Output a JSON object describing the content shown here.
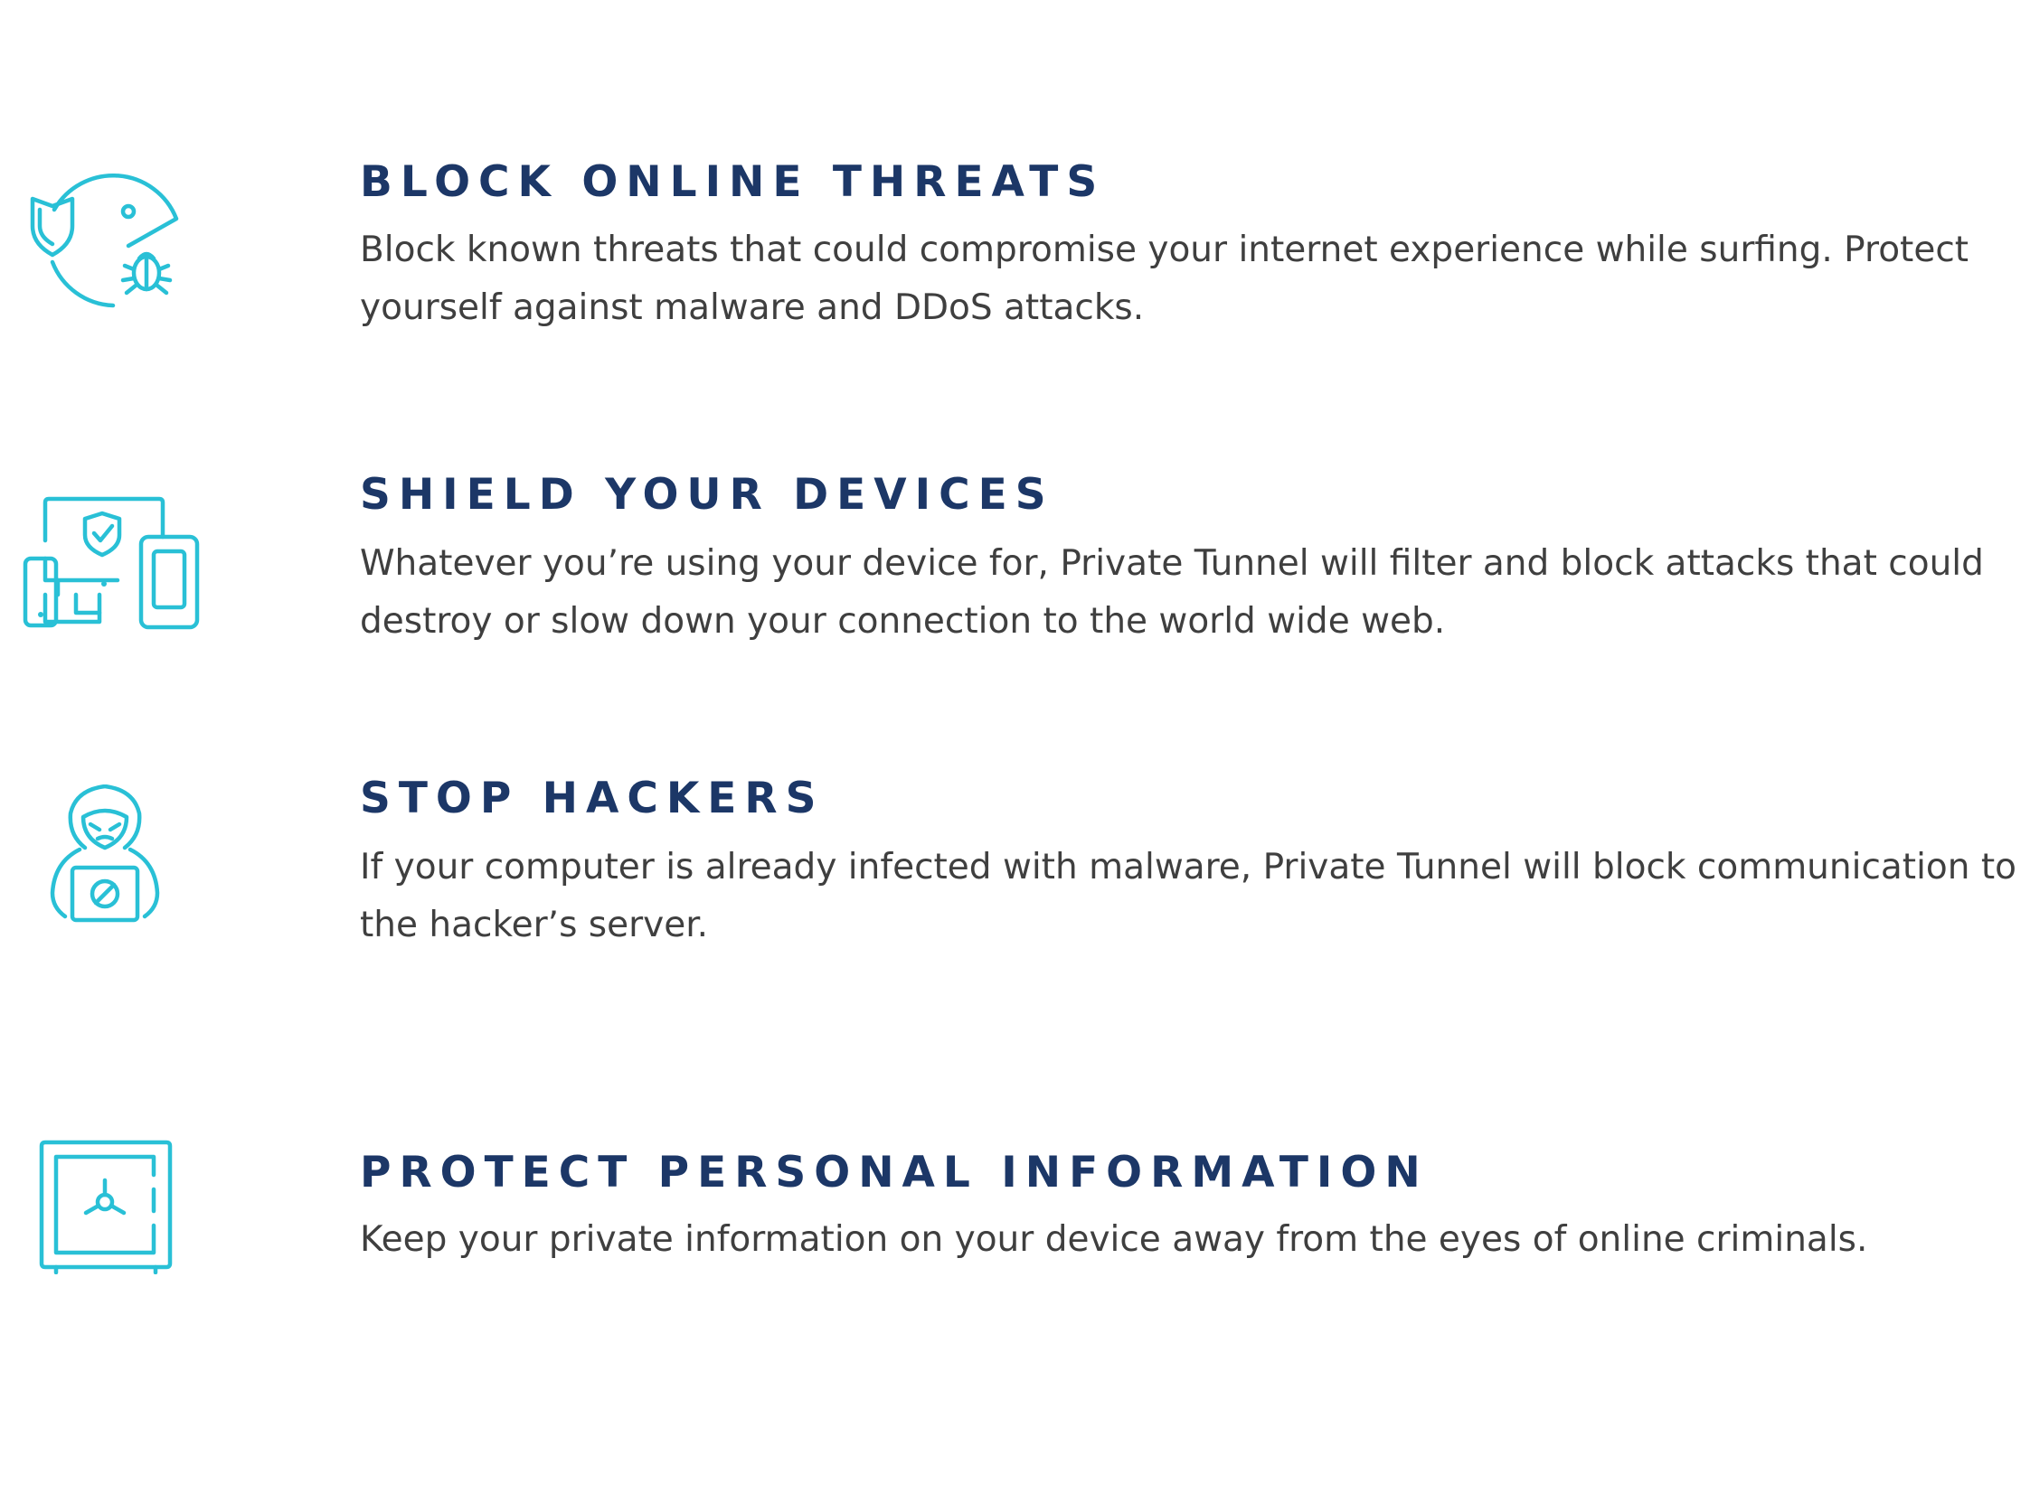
{
  "colors": {
    "heading": "#1c3767",
    "body_text": "#3f3f3f",
    "icon_accent": "#29c0d6",
    "background": "#ffffff"
  },
  "features": [
    {
      "icon": "threat-block-icon",
      "title": "BLOCK ONLINE THREATS",
      "lines": [
        "Block known threats that could compromise your internet experience while surfing. Protect",
        "yourself against malware and DDoS attacks."
      ]
    },
    {
      "icon": "devices-shield-icon",
      "title": "SHIELD YOUR DEVICES",
      "lines": [
        "Whatever you’re using your device for, Private Tunnel will filter and block attacks that could",
        "destroy or slow down your connection to the world wide web."
      ]
    },
    {
      "icon": "hacker-icon",
      "title": "STOP HACKERS",
      "lines": [
        "If your computer is already infected with malware, Private Tunnel will block communication to",
        "the hacker’s server."
      ]
    },
    {
      "icon": "safe-vault-icon",
      "title": "PROTECT PERSONAL INFORMATION",
      "lines": [
        "Keep your private information on your device away from the eyes of online criminals."
      ]
    }
  ]
}
